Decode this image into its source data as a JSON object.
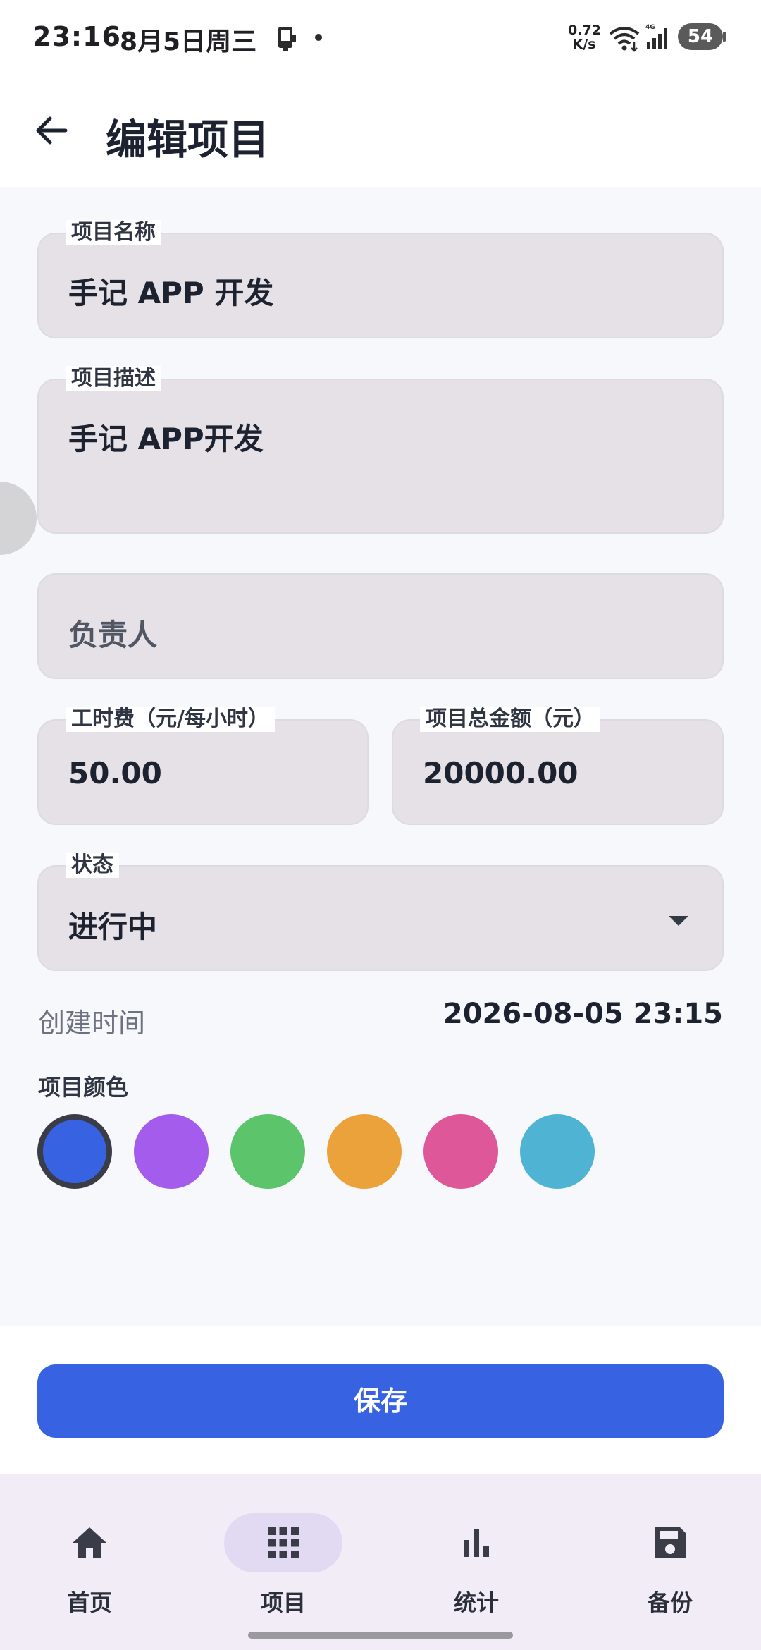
{
  "status_bar": {
    "time": "23:16",
    "date": "8月5日周三",
    "network_speed_value": "0.72",
    "network_speed_unit": "K/s",
    "signal_type": "4G",
    "battery": "54"
  },
  "app_bar": {
    "title": "编辑项目",
    "back_icon": "arrow-left-icon"
  },
  "form": {
    "project_name": {
      "label": "项目名称",
      "value": "手记 APP 开发"
    },
    "project_description": {
      "label": "项目描述",
      "value": "手记 APP开发"
    },
    "owner": {
      "placeholder": "负责人",
      "value": ""
    },
    "hourly_rate": {
      "label": "工时费（元/每小时）",
      "value": "50.00"
    },
    "total_amount": {
      "label": "项目总金额（元）",
      "value": "20000.00"
    },
    "status": {
      "label": "状态",
      "value": "进行中"
    },
    "created_time": {
      "label": "创建时间",
      "value": "2026-08-05 23:15"
    },
    "project_color": {
      "label": "项目颜色",
      "options": [
        "#3763e3",
        "#a35ceb",
        "#5cc46a",
        "#eba23b",
        "#de5798",
        "#4fb3d4"
      ],
      "selected_index": 0
    }
  },
  "save_button": {
    "label": "保存"
  },
  "bottom_nav": {
    "items": [
      {
        "label": "首页",
        "icon": "home-icon",
        "active": false
      },
      {
        "label": "项目",
        "icon": "grid-icon",
        "active": true
      },
      {
        "label": "统计",
        "icon": "bar-chart-icon",
        "active": false
      },
      {
        "label": "备份",
        "icon": "save-icon",
        "active": false
      }
    ]
  },
  "colors": {
    "accent": "#3763e3",
    "field_bg": "#e5e1e7",
    "nav_bg": "#f1ecf6",
    "nav_active_pill": "#e1daf2"
  }
}
